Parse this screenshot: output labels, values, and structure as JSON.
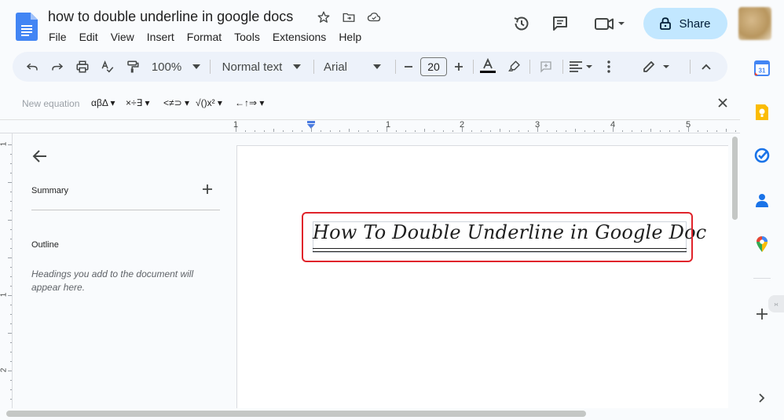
{
  "doc": {
    "title": "how to double underline in google docs",
    "heading": "How To Double Underline in Google Doc"
  },
  "menu": [
    "File",
    "Edit",
    "View",
    "Insert",
    "Format",
    "Tools",
    "Extensions",
    "Help"
  ],
  "share_label": "Share",
  "toolbar": {
    "zoom": "100%",
    "style": "Normal text",
    "font": "Arial",
    "font_size": "20"
  },
  "equation_bar": {
    "new_equation": "New equation",
    "groups": [
      "αβΔ",
      "×÷∃",
      "<≠⊃",
      "√()x²",
      "←↑⇒"
    ]
  },
  "ruler": {
    "marks": [
      "1",
      "1",
      "2",
      "3",
      "4",
      "5"
    ],
    "vertical_marks": [
      "1",
      "1",
      "2"
    ]
  },
  "outline_panel": {
    "summary_label": "Summary",
    "outline_label": "Outline",
    "hint": "Headings you add to the document will appear here."
  },
  "side_panel": {
    "calendar_day": "31"
  },
  "colors": {
    "accent": "#1a73e8",
    "share_bg": "#c2e7ff",
    "highlight_border": "#e0242b",
    "toolbar_bg": "#edf2fa"
  }
}
